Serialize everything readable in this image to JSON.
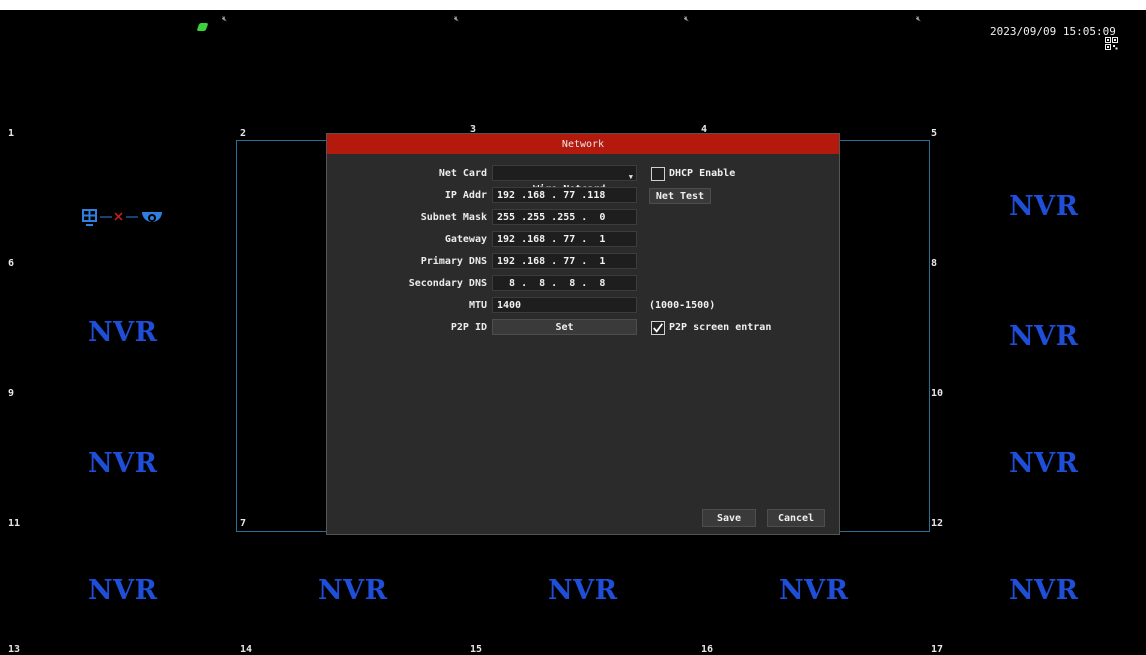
{
  "datetime": "2023/09/09 15:05:09",
  "channels": [
    "1",
    "2",
    "3",
    "4",
    "5",
    "6",
    "7",
    "8",
    "9",
    "10",
    "11",
    "12",
    "13",
    "14",
    "15",
    "16",
    "17"
  ],
  "nvr_label": "NVR",
  "dialog": {
    "title": "Network",
    "net_card_label": "Net Card",
    "net_card_value": "Wire Netcard",
    "dhcp_label": "DHCP Enable",
    "dhcp_checked": false,
    "ip_label": "IP Addr",
    "ip_value": "192 .168 . 77 .118",
    "net_test_label": "Net Test",
    "subnet_label": "Subnet Mask",
    "subnet_value": "255 .255 .255 .  0",
    "gateway_label": "Gateway",
    "gateway_value": "192 .168 . 77 .  1",
    "primary_dns_label": "Primary DNS",
    "primary_dns_value": "192 .168 . 77 .  1",
    "secondary_dns_label": "Secondary DNS",
    "secondary_dns_value": "  8 .  8 .  8 .  8",
    "mtu_label": "MTU",
    "mtu_value": "1400",
    "mtu_range": "(1000-1500)",
    "p2p_label": "P2P ID",
    "p2p_set_label": "Set",
    "p2p_screen_label": "P2P screen entran",
    "p2p_screen_checked": true,
    "save_label": "Save",
    "cancel_label": "Cancel"
  },
  "colors": {
    "title_bar": "#b4190d",
    "nvr_text": "#1f4ed8",
    "selected_frame": "#2a6f93"
  }
}
